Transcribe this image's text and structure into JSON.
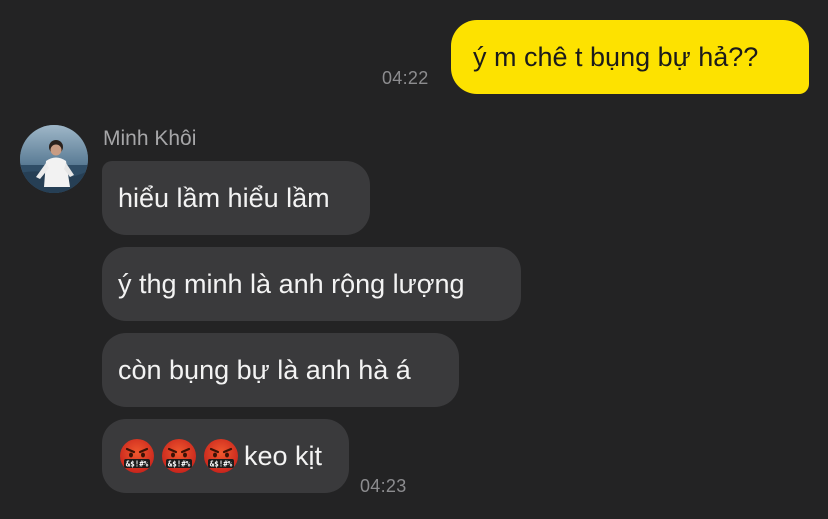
{
  "conversation": {
    "outgoing": {
      "text": "ý m chê t bụng bự hả??",
      "time": "04:22"
    },
    "incoming": {
      "sender_name": "Minh Khôi",
      "messages": [
        "hiểu lầm hiểu lầm",
        "ý thg minh là anh rộng lượng",
        "còn bụng bự là anh hà á",
        "keo kịt"
      ],
      "emoji": "face-with-symbols-on-mouth-icon",
      "emoji_count": 3,
      "time": "04:23"
    }
  },
  "colors": {
    "background": "#232324",
    "outgoing_bubble": "#fde200",
    "incoming_bubble": "#3a3a3c",
    "timestamp": "#8c8c8f"
  }
}
